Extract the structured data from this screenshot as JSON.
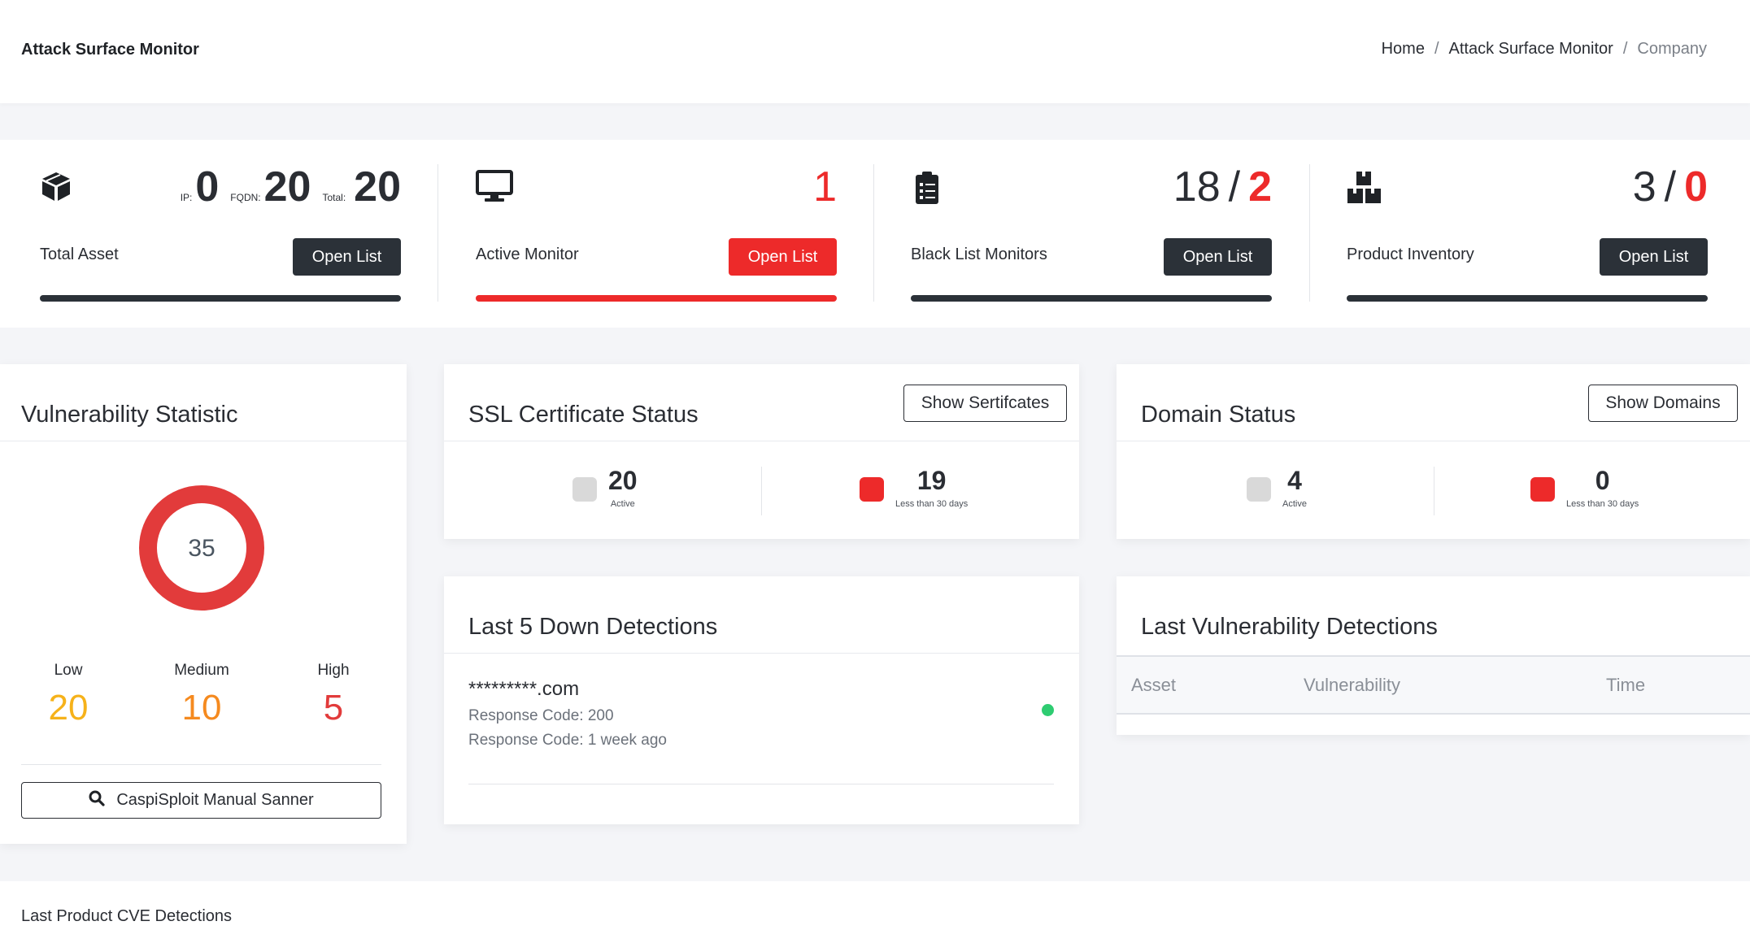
{
  "header": {
    "app_title": "Attack Surface Monitor",
    "breadcrumb": [
      "Home",
      "Attack Surface Monitor",
      "Company"
    ]
  },
  "stats": {
    "total_asset": {
      "label": "Total Asset",
      "ip_label": "IP:",
      "ip_value": "0",
      "fqdn_label": "FQDN:",
      "fqdn_value": "20",
      "total_label": "Total:",
      "total_value": "20",
      "button": "Open List",
      "icon": "cube-icon"
    },
    "active_monitor": {
      "label": "Active Monitor",
      "value": "1",
      "button": "Open List",
      "icon": "monitor-icon"
    },
    "black_list": {
      "label": "Black List Monitors",
      "value_a": "18",
      "sep": "/",
      "value_b": "2",
      "button": "Open List",
      "icon": "clipboard-icon"
    },
    "product_inventory": {
      "label": "Product Inventory",
      "value_a": "3",
      "sep": "/",
      "value_b": "0",
      "button": "Open List",
      "icon": "boxes-icon"
    }
  },
  "vulnerability": {
    "title": "Vulnerability Statistic",
    "total": "35",
    "low_label": "Low",
    "low": "20",
    "medium_label": "Medium",
    "medium": "10",
    "high_label": "High",
    "high": "5",
    "scanner_button": "CaspiSploit Manual Sanner"
  },
  "ssl": {
    "title": "SSL Certificate Status",
    "button": "Show Sertifcates",
    "active_value": "20",
    "active_label": "Active",
    "expiring_value": "19",
    "expiring_label": "Less than 30 days"
  },
  "domain": {
    "title": "Domain Status",
    "button": "Show Domains",
    "active_value": "4",
    "active_label": "Active",
    "expiring_value": "0",
    "expiring_label": "Less than 30 days"
  },
  "down_detections": {
    "title": "Last 5 Down Detections",
    "items": [
      {
        "host": "*********.com",
        "line1": "Response Code: 200",
        "line2": "Response Code: 1 week ago",
        "status": "up"
      }
    ]
  },
  "vuln_detections": {
    "title": "Last Vulnerability Detections",
    "columns": [
      "Asset",
      "Vulnerability",
      "Time"
    ]
  },
  "cve": {
    "title": "Last Product CVE Detections"
  },
  "colors": {
    "accent_red": "#ed2a2a",
    "dark": "#2b3138",
    "low": "#f6b21a",
    "medium": "#f58a1f",
    "high": "#e23b3b",
    "online": "#2ecc71"
  }
}
